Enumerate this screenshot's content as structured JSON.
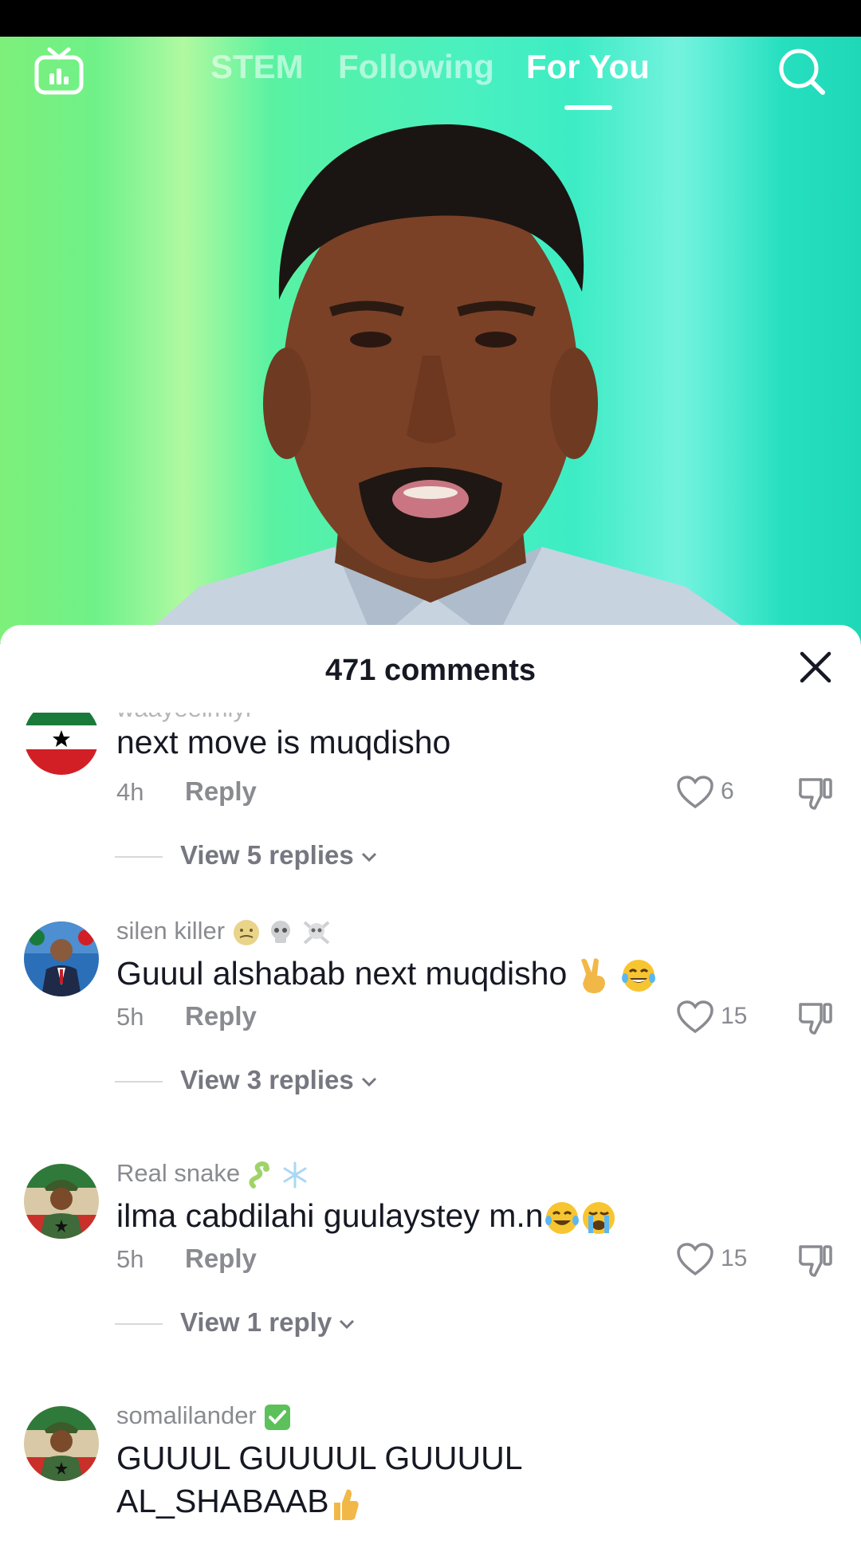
{
  "nav": {
    "tabs": [
      {
        "label": "STEM"
      },
      {
        "label": "Following"
      },
      {
        "label": "For You"
      }
    ],
    "active_tab": "For You"
  },
  "comments_sheet": {
    "title": "471 comments",
    "comments": [
      {
        "username": "waayeelmiyi",
        "text": "next move is muqdisho",
        "time": "4h",
        "reply_label": "Reply",
        "likes": "6",
        "view_replies": "View 5 replies"
      },
      {
        "username": "silen killer",
        "text": "Guuul alshabab next muqdisho",
        "time": "5h",
        "reply_label": "Reply",
        "likes": "15",
        "view_replies": "View 3 replies"
      },
      {
        "username": "Real snake",
        "text": "ilma cabdilahi guulaystey m.n",
        "time": "5h",
        "reply_label": "Reply",
        "likes": "15",
        "view_replies": "View 1 reply"
      },
      {
        "username": "somalilander",
        "text_line1": "GUUUL GUUUUL GUUUUL",
        "text_line2": "AL_SHABAAB"
      }
    ]
  },
  "colors": {
    "accent_text": "#161823",
    "muted_text": "#8a8b91",
    "sheet_bg": "#ffffff"
  },
  "icons": [
    "live-tv-icon",
    "search-icon",
    "close-icon",
    "heart-icon",
    "dislike-icon",
    "chevron-down-icon"
  ]
}
